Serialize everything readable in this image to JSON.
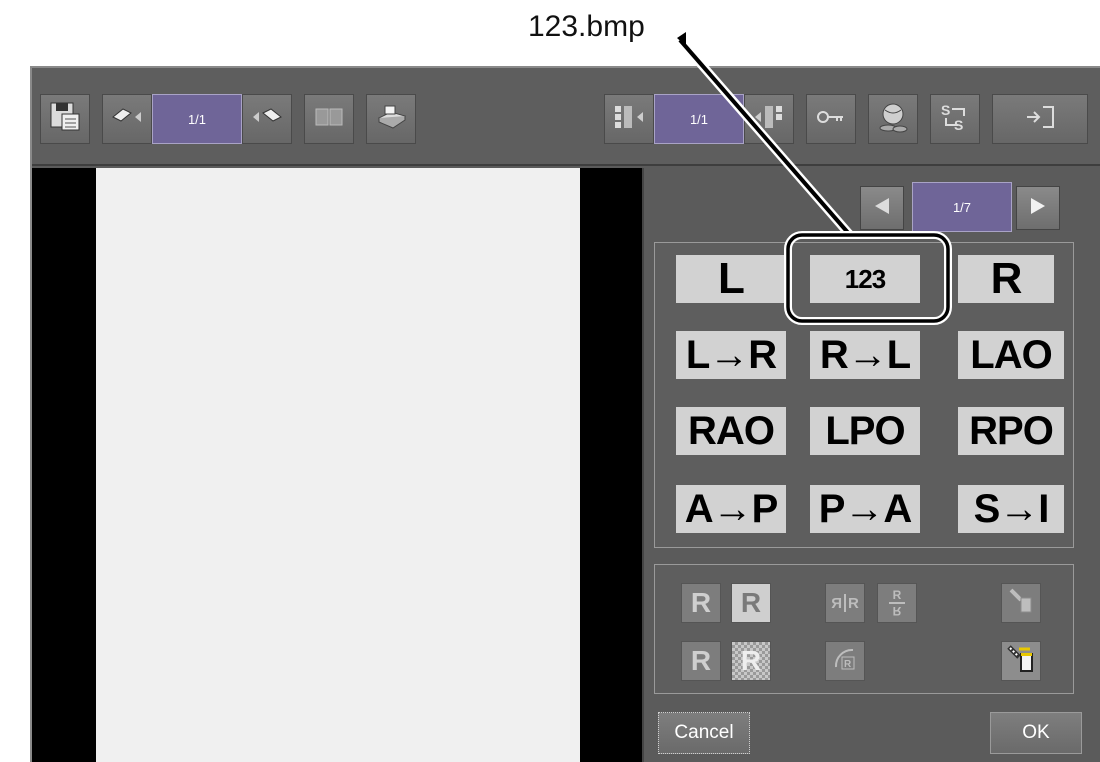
{
  "callout": {
    "filename": "123.bmp"
  },
  "toolbar": {
    "image_pager": "1/1",
    "series_pager": "1/1"
  },
  "panel": {
    "page_indicator": "1/7",
    "markers": [
      {
        "label": "L"
      },
      {
        "label": "123"
      },
      {
        "label": "R"
      },
      {
        "label": "L→R"
      },
      {
        "label": "R→L"
      },
      {
        "label": "LAO"
      },
      {
        "label": "RAO"
      },
      {
        "label": "LPO"
      },
      {
        "label": "RPO"
      },
      {
        "label": "A→P"
      },
      {
        "label": "P→A"
      },
      {
        "label": "S→I"
      }
    ],
    "tools": {
      "r_plain": "R",
      "r_boxed": "R",
      "r_plain_2": "R",
      "r_mosaic": "R",
      "flip_left": "Я",
      "flip_right": "R",
      "rotate_top": "R",
      "rotate_bottom": "R"
    },
    "cancel_label": "Cancel",
    "ok_label": "OK"
  },
  "colors": {
    "pager_bg": "#6f6598",
    "chrome_bg": "#5b5b5b",
    "marker_bg": "#d2d2d2"
  }
}
